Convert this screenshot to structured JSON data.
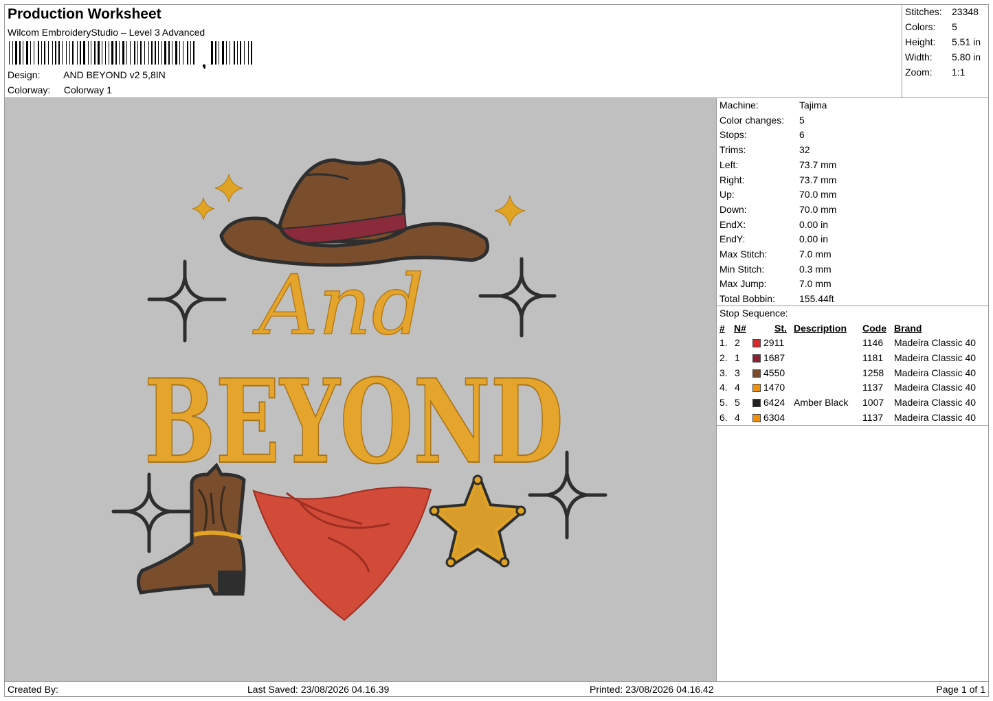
{
  "header": {
    "title": "Production Worksheet",
    "subtitle": "Wilcom EmbroideryStudio – Level 3 Advanced",
    "design_label": "Design:",
    "design_value": "AND BEYOND v2 5,8IN",
    "colorway_label": "Colorway:",
    "colorway_value": "Colorway 1"
  },
  "stats": [
    {
      "label": "Stitches:",
      "value": "23348"
    },
    {
      "label": "Colors:",
      "value": "5"
    },
    {
      "label": "Height:",
      "value": "5.51 in"
    },
    {
      "label": "Width:",
      "value": "5.80 in"
    },
    {
      "label": "Zoom:",
      "value": "1:1"
    }
  ],
  "design": {
    "word_top": "And",
    "word_main": "BEYOND"
  },
  "machine": [
    {
      "label": "Machine:",
      "value": "Tajima"
    },
    {
      "label": "Color changes:",
      "value": "5"
    },
    {
      "label": "Stops:",
      "value": "6"
    },
    {
      "label": "Trims:",
      "value": "32"
    },
    {
      "label": "Left:",
      "value": "73.7 mm"
    },
    {
      "label": "Right:",
      "value": "73.7 mm"
    },
    {
      "label": "Up:",
      "value": "70.0 mm"
    },
    {
      "label": "Down:",
      "value": "70.0 mm"
    },
    {
      "label": "EndX:",
      "value": "0.00 in"
    },
    {
      "label": "EndY:",
      "value": "0.00 in"
    },
    {
      "label": "Max Stitch:",
      "value": "7.0 mm"
    },
    {
      "label": "Min Stitch:",
      "value": "0.3 mm"
    },
    {
      "label": "Max Jump:",
      "value": "7.0 mm"
    },
    {
      "label": "Total Bobbin:",
      "value": "155.44ft"
    }
  ],
  "stop_sequence": {
    "label": "Stop Sequence:",
    "headers": {
      "num": "#",
      "n": "N#",
      "st": "St.",
      "description": "Description",
      "code": "Code",
      "brand": "Brand"
    },
    "rows": [
      {
        "num": "1.",
        "n": "2",
        "color": "#d42a2a",
        "st": "2911",
        "description": "",
        "code": "1146",
        "brand": "Madeira Classic 40"
      },
      {
        "num": "2.",
        "n": "1",
        "color": "#8e2030",
        "st": "1687",
        "description": "",
        "code": "1181",
        "brand": "Madeira Classic 40"
      },
      {
        "num": "3.",
        "n": "3",
        "color": "#7a4a2a",
        "st": "4550",
        "description": "",
        "code": "1258",
        "brand": "Madeira Classic 40"
      },
      {
        "num": "4.",
        "n": "4",
        "color": "#f0900a",
        "st": "1470",
        "description": "",
        "code": "1137",
        "brand": "Madeira Classic 40"
      },
      {
        "num": "5.",
        "n": "5",
        "color": "#222222",
        "st": "6424",
        "description": "Amber Black",
        "code": "1007",
        "brand": "Madeira Classic 40"
      },
      {
        "num": "6.",
        "n": "4",
        "color": "#f0900a",
        "st": "6304",
        "description": "",
        "code": "1137",
        "brand": "Madeira Classic 40"
      }
    ]
  },
  "footer": {
    "created_by": "Created By:",
    "last_saved": "Last Saved: 23/08/2026 04.16.39",
    "printed": "Printed: 23/08/2026 04.16.42",
    "page": "Page 1 of 1"
  }
}
